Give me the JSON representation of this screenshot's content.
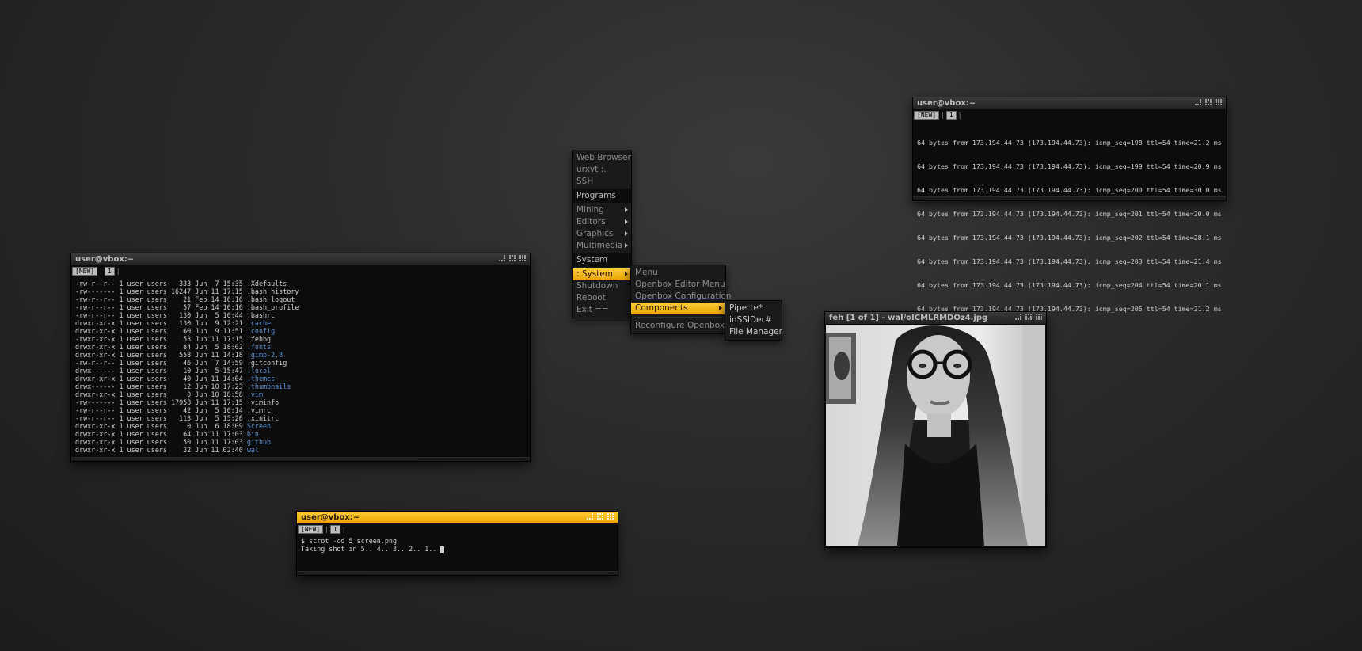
{
  "ls_window": {
    "title": "user@vbox:~",
    "tabs": [
      "[NEW]",
      "|",
      "1",
      "|"
    ],
    "listing": [
      {
        "perm": "-rw-r--r--",
        "links": "1",
        "user": "user",
        "group": "users",
        "size": "333",
        "month": "Jun",
        "day": "7",
        "time": "15:35",
        "name": ".Xdefaults",
        "color": "plain"
      },
      {
        "perm": "-rw-------",
        "links": "1",
        "user": "user",
        "group": "users",
        "size": "16247",
        "month": "Jun",
        "day": "11",
        "time": "17:15",
        "name": ".bash_history",
        "color": "plain"
      },
      {
        "perm": "-rw-r--r--",
        "links": "1",
        "user": "user",
        "group": "users",
        "size": "21",
        "month": "Feb",
        "day": "14",
        "time": "16:16",
        "name": ".bash_logout",
        "color": "plain"
      },
      {
        "perm": "-rw-r--r--",
        "links": "1",
        "user": "user",
        "group": "users",
        "size": "57",
        "month": "Feb",
        "day": "14",
        "time": "16:16",
        "name": ".bash_profile",
        "color": "plain"
      },
      {
        "perm": "-rw-r--r--",
        "links": "1",
        "user": "user",
        "group": "users",
        "size": "130",
        "month": "Jun",
        "day": "5",
        "time": "16:44",
        "name": ".bashrc",
        "color": "plain"
      },
      {
        "perm": "drwxr-xr-x",
        "links": "1",
        "user": "user",
        "group": "users",
        "size": "130",
        "month": "Jun",
        "day": "9",
        "time": "12:21",
        "name": ".cache",
        "color": "blue"
      },
      {
        "perm": "drwxr-xr-x",
        "links": "1",
        "user": "user",
        "group": "users",
        "size": "60",
        "month": "Jun",
        "day": "9",
        "time": "11:51",
        "name": ".config",
        "color": "blue"
      },
      {
        "perm": "-rwxr-xr-x",
        "links": "1",
        "user": "user",
        "group": "users",
        "size": "53",
        "month": "Jun",
        "day": "11",
        "time": "17:15",
        "name": ".fehbg",
        "color": "plain"
      },
      {
        "perm": "drwxr-xr-x",
        "links": "1",
        "user": "user",
        "group": "users",
        "size": "84",
        "month": "Jun",
        "day": "5",
        "time": "18:02",
        "name": ".fonts",
        "color": "blue"
      },
      {
        "perm": "drwxr-xr-x",
        "links": "1",
        "user": "user",
        "group": "users",
        "size": "558",
        "month": "Jun",
        "day": "11",
        "time": "14:18",
        "name": ".gimp-2.8",
        "color": "blue"
      },
      {
        "perm": "-rw-r--r--",
        "links": "1",
        "user": "user",
        "group": "users",
        "size": "46",
        "month": "Jun",
        "day": "7",
        "time": "14:59",
        "name": ".gitconfig",
        "color": "plain"
      },
      {
        "perm": "drwx------",
        "links": "1",
        "user": "user",
        "group": "users",
        "size": "10",
        "month": "Jun",
        "day": "5",
        "time": "15:47",
        "name": ".local",
        "color": "blue"
      },
      {
        "perm": "drwxr-xr-x",
        "links": "1",
        "user": "user",
        "group": "users",
        "size": "40",
        "month": "Jun",
        "day": "11",
        "time": "14:04",
        "name": ".themes",
        "color": "blue"
      },
      {
        "perm": "drwx------",
        "links": "1",
        "user": "user",
        "group": "users",
        "size": "12",
        "month": "Jun",
        "day": "10",
        "time": "17:23",
        "name": ".thumbnails",
        "color": "blue"
      },
      {
        "perm": "drwxr-xr-x",
        "links": "1",
        "user": "user",
        "group": "users",
        "size": "0",
        "month": "Jun",
        "day": "10",
        "time": "18:58",
        "name": ".vim",
        "color": "blue"
      },
      {
        "perm": "-rw-------",
        "links": "1",
        "user": "user",
        "group": "users",
        "size": "17958",
        "month": "Jun",
        "day": "11",
        "time": "17:15",
        "name": ".viminfo",
        "color": "plain"
      },
      {
        "perm": "-rw-r--r--",
        "links": "1",
        "user": "user",
        "group": "users",
        "size": "42",
        "month": "Jun",
        "day": "5",
        "time": "16:14",
        "name": ".vimrc",
        "color": "plain"
      },
      {
        "perm": "-rw-r--r--",
        "links": "1",
        "user": "user",
        "group": "users",
        "size": "113",
        "month": "Jun",
        "day": "5",
        "time": "15:26",
        "name": ".xinitrc",
        "color": "plain"
      },
      {
        "perm": "drwxr-xr-x",
        "links": "1",
        "user": "user",
        "group": "users",
        "size": "0",
        "month": "Jun",
        "day": "6",
        "time": "18:09",
        "name": "Screen",
        "color": "blue"
      },
      {
        "perm": "drwxr-xr-x",
        "links": "1",
        "user": "user",
        "group": "users",
        "size": "64",
        "month": "Jun",
        "day": "11",
        "time": "17:03",
        "name": "bin",
        "color": "blue"
      },
      {
        "perm": "drwxr-xr-x",
        "links": "1",
        "user": "user",
        "group": "users",
        "size": "50",
        "month": "Jun",
        "day": "11",
        "time": "17:03",
        "name": "github",
        "color": "blue"
      },
      {
        "perm": "drwxr-xr-x",
        "links": "1",
        "user": "user",
        "group": "users",
        "size": "32",
        "month": "Jun",
        "day": "11",
        "time": "02:40",
        "name": "wal",
        "color": "blue"
      }
    ]
  },
  "scrot_window": {
    "title": "user@vbox:~",
    "tabs": [
      "[NEW]",
      "|",
      "1",
      "|"
    ],
    "command": "$ scrot -cd 5 screen.png",
    "output": "Taking shot in 5.. 4.. 3.. 2.. 1.. "
  },
  "ping_window": {
    "title": "user@vbox:~",
    "tabs": [
      "[NEW]",
      "|",
      "1",
      "|"
    ],
    "lines": [
      "64 bytes from 173.194.44.73 (173.194.44.73): icmp_seq=198 ttl=54 time=21.2 ms",
      "64 bytes from 173.194.44.73 (173.194.44.73): icmp_seq=199 ttl=54 time=20.9 ms",
      "64 bytes from 173.194.44.73 (173.194.44.73): icmp_seq=200 ttl=54 time=30.0 ms",
      "64 bytes from 173.194.44.73 (173.194.44.73): icmp_seq=201 ttl=54 time=20.0 ms",
      "64 bytes from 173.194.44.73 (173.194.44.73): icmp_seq=202 ttl=54 time=28.1 ms",
      "64 bytes from 173.194.44.73 (173.194.44.73): icmp_seq=203 ttl=54 time=21.4 ms",
      "64 bytes from 173.194.44.73 (173.194.44.73): icmp_seq=204 ttl=54 time=20.1 ms",
      "64 bytes from 173.194.44.73 (173.194.44.73): icmp_seq=205 ttl=54 time=21.2 ms"
    ]
  },
  "feh_window": {
    "title": "feh [1 of 1] - wal/oICMLRMDOz4.jpg"
  },
  "root_menu": {
    "items": [
      "Web Browser",
      "urxvt :.",
      "SSH"
    ],
    "programs_header": "Programs",
    "program_items": [
      "Mining",
      "Editors",
      "Graphics",
      "Multimedia"
    ],
    "system_header": "System",
    "system_selected": ": System",
    "system_items": [
      "Shutdown",
      "Reboot",
      "Exit =="
    ]
  },
  "system_menu": {
    "items": [
      "Menu",
      "Openbox Editor Menu",
      "Openbox Configuration"
    ],
    "selected": "Components",
    "reconfigure": "Reconfigure Openbox"
  },
  "components_menu": {
    "items": [
      "Pipette*",
      "inSSIDer#",
      "File Manager"
    ]
  },
  "colors": {
    "accent": "#f5b800",
    "directory": "#5a8fd0",
    "terminal_text": "#cfcfcf",
    "terminal_bg": "#0c0c0c"
  }
}
